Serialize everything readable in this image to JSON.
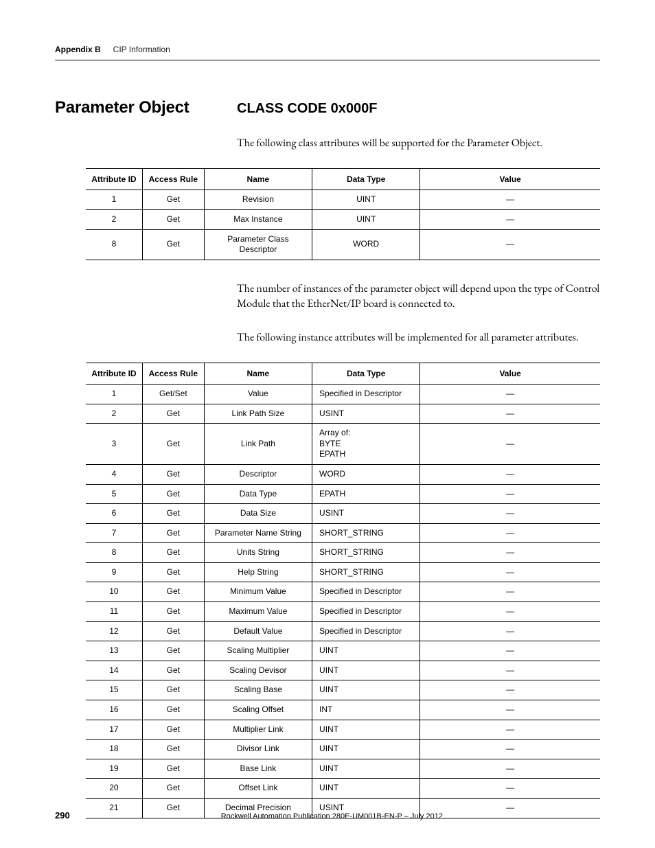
{
  "header": {
    "appendix": "Appendix B",
    "chapter": "CIP Information"
  },
  "titles": {
    "section": "Parameter Object",
    "class_code": "CLASS CODE 0x000F"
  },
  "paragraphs": {
    "p1": "The following class attributes will be supported for the Parameter Object.",
    "p2": "The number of instances of the parameter object will depend upon the type of Control Module that the EtherNet/IP board is connected to.",
    "p3": "The following instance attributes will be implemented for all parameter attributes."
  },
  "table_headers": {
    "attr_id": "Attribute ID",
    "access_rule": "Access Rule",
    "name": "Name",
    "data_type": "Data Type",
    "value": "Value"
  },
  "table1_rows": [
    {
      "id": "1",
      "rule": "Get",
      "name": "Revision",
      "type": "UINT",
      "val": "—"
    },
    {
      "id": "2",
      "rule": "Get",
      "name": "Max Instance",
      "type": "UINT",
      "val": "—"
    },
    {
      "id": "8",
      "rule": "Get",
      "name": "Parameter Class Descriptor",
      "type": "WORD",
      "val": "—"
    }
  ],
  "table2_rows": [
    {
      "id": "1",
      "rule": "Get/Set",
      "name": "Value",
      "type": "Specified in Descriptor",
      "val": "—"
    },
    {
      "id": "2",
      "rule": "Get",
      "name": "Link Path Size",
      "type": "USINT",
      "val": "—"
    },
    {
      "id": "3",
      "rule": "Get",
      "name": "Link Path",
      "type": "Array of:\nBYTE\nEPATH",
      "val": "—"
    },
    {
      "id": "4",
      "rule": "Get",
      "name": "Descriptor",
      "type": "WORD",
      "val": "—"
    },
    {
      "id": "5",
      "rule": "Get",
      "name": "Data Type",
      "type": "EPATH",
      "val": "—"
    },
    {
      "id": "6",
      "rule": "Get",
      "name": "Data Size",
      "type": "USINT",
      "val": "—"
    },
    {
      "id": "7",
      "rule": "Get",
      "name": "Parameter Name String",
      "type": "SHORT_STRING",
      "val": "—"
    },
    {
      "id": "8",
      "rule": "Get",
      "name": "Units String",
      "type": "SHORT_STRING",
      "val": "—"
    },
    {
      "id": "9",
      "rule": "Get",
      "name": "Help String",
      "type": "SHORT_STRING",
      "val": "—"
    },
    {
      "id": "10",
      "rule": "Get",
      "name": "Minimum Value",
      "type": "Specified in Descriptor",
      "val": "—"
    },
    {
      "id": "11",
      "rule": "Get",
      "name": "Maximum Value",
      "type": "Specified in Descriptor",
      "val": "—"
    },
    {
      "id": "12",
      "rule": "Get",
      "name": "Default Value",
      "type": "Specified in Descriptor",
      "val": "—"
    },
    {
      "id": "13",
      "rule": "Get",
      "name": "Scaling Multiplier",
      "type": "UINT",
      "val": "—"
    },
    {
      "id": "14",
      "rule": "Get",
      "name": "Scaling Devisor",
      "type": "UINT",
      "val": "—"
    },
    {
      "id": "15",
      "rule": "Get",
      "name": "Scaling Base",
      "type": "UINT",
      "val": "—"
    },
    {
      "id": "16",
      "rule": "Get",
      "name": "Scaling Offset",
      "type": "INT",
      "val": "—"
    },
    {
      "id": "17",
      "rule": "Get",
      "name": "Multiplier Link",
      "type": "UINT",
      "val": "—"
    },
    {
      "id": "18",
      "rule": "Get",
      "name": "Divisor Link",
      "type": "UINT",
      "val": "—"
    },
    {
      "id": "19",
      "rule": "Get",
      "name": "Base Link",
      "type": "UINT",
      "val": "—"
    },
    {
      "id": "20",
      "rule": "Get",
      "name": "Offset Link",
      "type": "UINT",
      "val": "—"
    },
    {
      "id": "21",
      "rule": "Get",
      "name": "Decimal Precision",
      "type": "USINT",
      "val": "—"
    }
  ],
  "footer": {
    "page": "290",
    "publication": "Rockwell Automation Publication 280E-UM001B-EN-P – July 2012"
  }
}
